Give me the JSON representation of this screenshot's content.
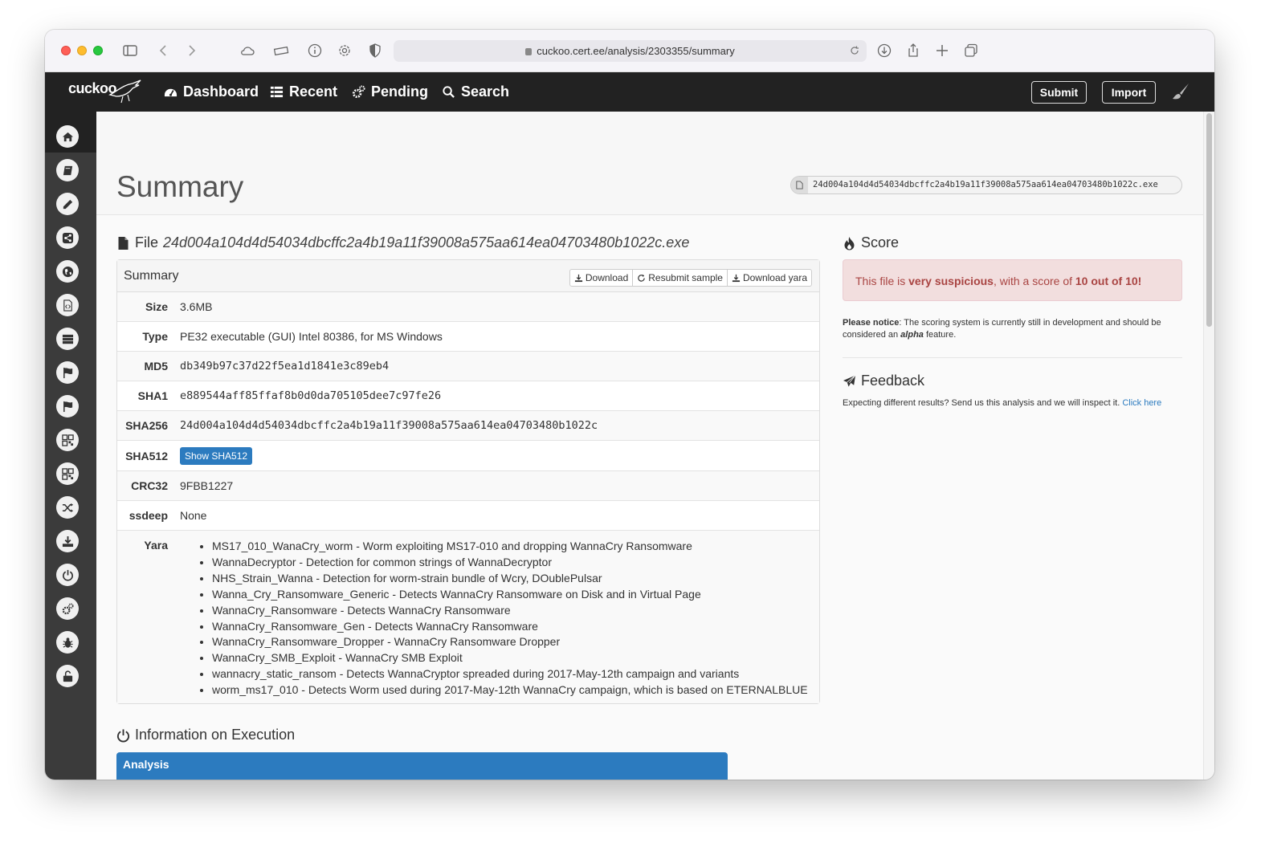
{
  "browser": {
    "url": "cuckoo.cert.ee/analysis/2303355/summary"
  },
  "navbar": {
    "logo": "cuckoo",
    "items": [
      {
        "label": "Dashboard",
        "icon": "dashboard-icon"
      },
      {
        "label": "Recent",
        "icon": "list-icon"
      },
      {
        "label": "Pending",
        "icon": "cogs-icon"
      },
      {
        "label": "Search",
        "icon": "search-icon"
      }
    ],
    "submit_label": "Submit",
    "import_label": "Import"
  },
  "sidebar": {
    "icons": [
      "home-icon",
      "book-icon",
      "pencil-icon",
      "share-icon",
      "globe-icon",
      "file-code-icon",
      "server-icon",
      "flag-icon",
      "flag-icon",
      "qrcode-icon",
      "qrcode-icon",
      "random-icon",
      "download-icon",
      "power-icon",
      "cogs-icon",
      "bug-icon",
      "unlock-icon"
    ]
  },
  "page": {
    "title": "Summary",
    "filename": "24d004a104d4d54034dbcffc2a4b19a11f39008a575aa614ea04703480b1022c.exe"
  },
  "file_section": {
    "title_prefix": "File",
    "filename": "24d004a104d4d54034dbcffc2a4b19a11f39008a575aa614ea04703480b1022c.exe",
    "panel_title": "Summary",
    "buttons": {
      "download": "Download",
      "resubmit": "Resubmit sample",
      "download_yara": "Download yara"
    },
    "rows": {
      "size": {
        "label": "Size",
        "value": "3.6MB"
      },
      "type": {
        "label": "Type",
        "value": "PE32 executable (GUI) Intel 80386, for MS Windows"
      },
      "md5": {
        "label": "MD5",
        "value": "db349b97c37d22f5ea1d1841e3c89eb4"
      },
      "sha1": {
        "label": "SHA1",
        "value": "e889544aff85ffaf8b0d0da705105dee7c97fe26"
      },
      "sha256": {
        "label": "SHA256",
        "value": "24d004a104d4d54034dbcffc2a4b19a11f39008a575aa614ea04703480b1022c"
      },
      "sha512": {
        "label": "SHA512",
        "button": "Show SHA512"
      },
      "crc32": {
        "label": "CRC32",
        "value": "9FBB1227"
      },
      "ssdeep": {
        "label": "ssdeep",
        "value": "None"
      },
      "yara": {
        "label": "Yara"
      }
    },
    "yara": [
      "MS17_010_WanaCry_worm - Worm exploiting MS17-010 and dropping WannaCry Ransomware",
      "WannaDecryptor - Detection for common strings of WannaDecryptor",
      "NHS_Strain_Wanna - Detection for worm-strain bundle of Wcry, DOublePulsar",
      "Wanna_Cry_Ransomware_Generic - Detects WannaCry Ransomware on Disk and in Virtual Page",
      "WannaCry_Ransomware - Detects WannaCry Ransomware",
      "WannaCry_Ransomware_Gen - Detects WannaCry Ransomware",
      "WannaCry_Ransomware_Dropper - WannaCry Ransomware Dropper",
      "WannaCry_SMB_Exploit - WannaCry SMB Exploit",
      "wannacry_static_ransom - Detects WannaCryptor spreaded during 2017-May-12th campaign and variants",
      "worm_ms17_010 - Detects Worm used during 2017-May-12th WannaCry campaign, which is based on ETERNALBLUE"
    ]
  },
  "execution": {
    "title": "Information on Execution",
    "analysis_label": "Analysis"
  },
  "score": {
    "title": "Score",
    "text_prefix": "This file is ",
    "text_strong": "very suspicious",
    "text_mid": ", with a score of ",
    "text_score": "10 out of 10!",
    "notice_strong": "Please notice",
    "notice_text": ": The scoring system is currently still in development and should be considered an ",
    "notice_em": "alpha",
    "notice_end": " feature."
  },
  "feedback": {
    "title": "Feedback",
    "text": "Expecting different results? Send us this analysis and we will inspect it. ",
    "link": "Click here"
  },
  "colors": {
    "navbar": "#222222",
    "sidebar": "#3b3b3b",
    "primary": "#2c7bbf",
    "danger_bg": "#f2dede",
    "danger_text": "#a94442"
  }
}
